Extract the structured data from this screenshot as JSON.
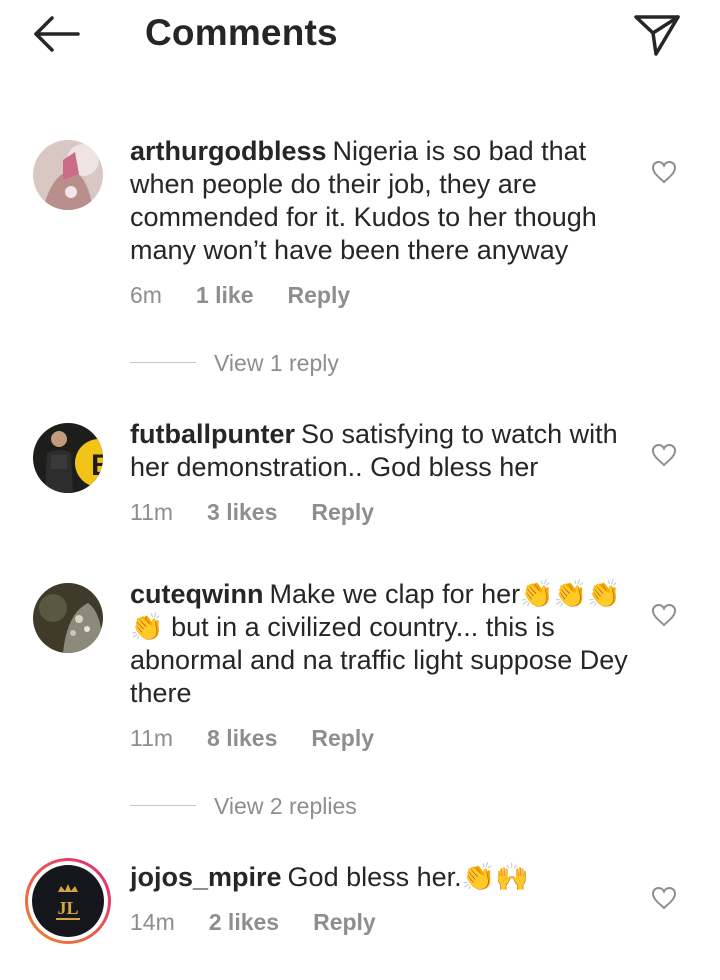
{
  "header": {
    "title": "Comments",
    "back_icon": "arrow-left-icon",
    "send_icon": "paper-plane-icon"
  },
  "comments": [
    {
      "username": "arthurgodbless",
      "text": "Nigeria is so bad that when people do their job, they are commended for it. Kudos to her though many won’t have been there anyway",
      "time": "6m",
      "likes": "1 like",
      "reply": "Reply",
      "view_replies": "View 1 reply"
    },
    {
      "username": "futballpunter",
      "text": "So satisfying to watch with her demonstration.. God bless her",
      "time": "11m",
      "likes": "3 likes",
      "reply": "Reply"
    },
    {
      "username": "cuteqwinn",
      "text": "Make we clap for her👏👏👏👏 but in a civilized country... this is abnormal and na traffic light suppose Dey there",
      "time": "11m",
      "likes": "8 likes",
      "reply": "Reply",
      "view_replies": "View 2 replies"
    },
    {
      "username": "jojos_mpire",
      "text": "God bless her.👏🙌",
      "time": "14m",
      "likes": "2 likes",
      "reply": "Reply"
    }
  ],
  "colors": {
    "text": "#262626",
    "meta": "#8e8e8e",
    "story_ring_start": "#f58529",
    "story_ring_end": "#dd2a7b"
  }
}
